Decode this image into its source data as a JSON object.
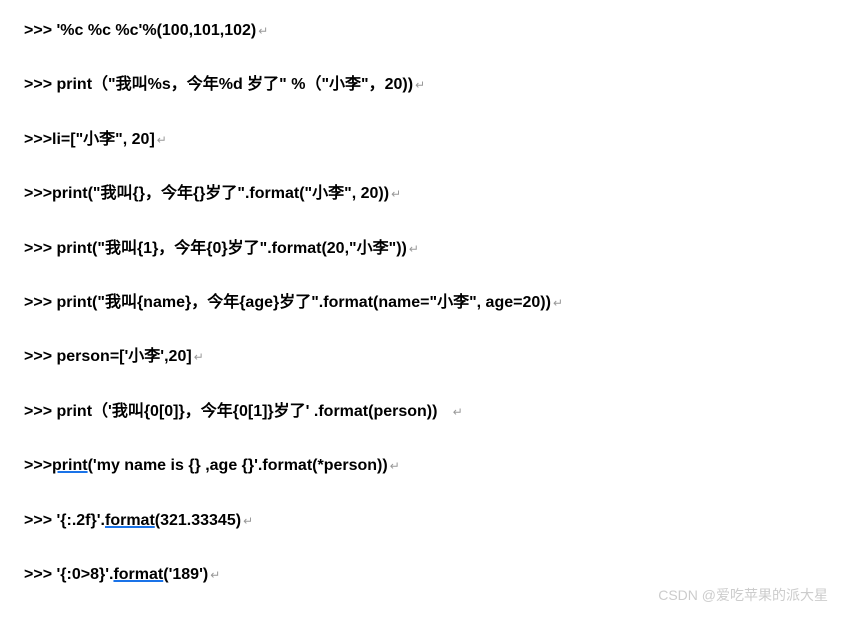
{
  "lines": [
    {
      "text": ">>> '%c %c %c'%(100,101,102)",
      "underlines": []
    },
    {
      "text": ">>> print（\"我叫%s，今年%d 岁了\" %（\"小李\"，20))",
      "underlines": []
    },
    {
      "text": ">>>li=[\"小李\", 20]",
      "underlines": []
    },
    {
      "text": ">>>print(\"我叫{}，今年{}岁了\".format(\"小李\", 20))",
      "underlines": []
    },
    {
      "text": ">>> print(\"我叫{1}，今年{0}岁了\".format(20,\"小李\"))",
      "underlines": []
    },
    {
      "text": ">>> print(\"我叫{name}，今年{age}岁了\".format(name=\"小李\", age=20))",
      "underlines": []
    },
    {
      "text": ">>> person=['小李',20]",
      "underlines": []
    },
    {
      "text": ">>> print（'我叫{0[0]}，今年{0[1]}岁了' .format(person))   ",
      "underlines": []
    },
    {
      "text": ">>>print('my name is {} ,age {}'.format(*person))",
      "underlines": [
        "print"
      ]
    },
    {
      "text": ">>> '{:.2f}'.format(321.33345)",
      "underlines": [
        "format"
      ]
    },
    {
      "text": ">>> '{:0>8}'.format('189')",
      "underlines": [
        "format"
      ]
    }
  ],
  "newline_char": "↵",
  "watermark": "CSDN @爱吃苹果的派大星"
}
